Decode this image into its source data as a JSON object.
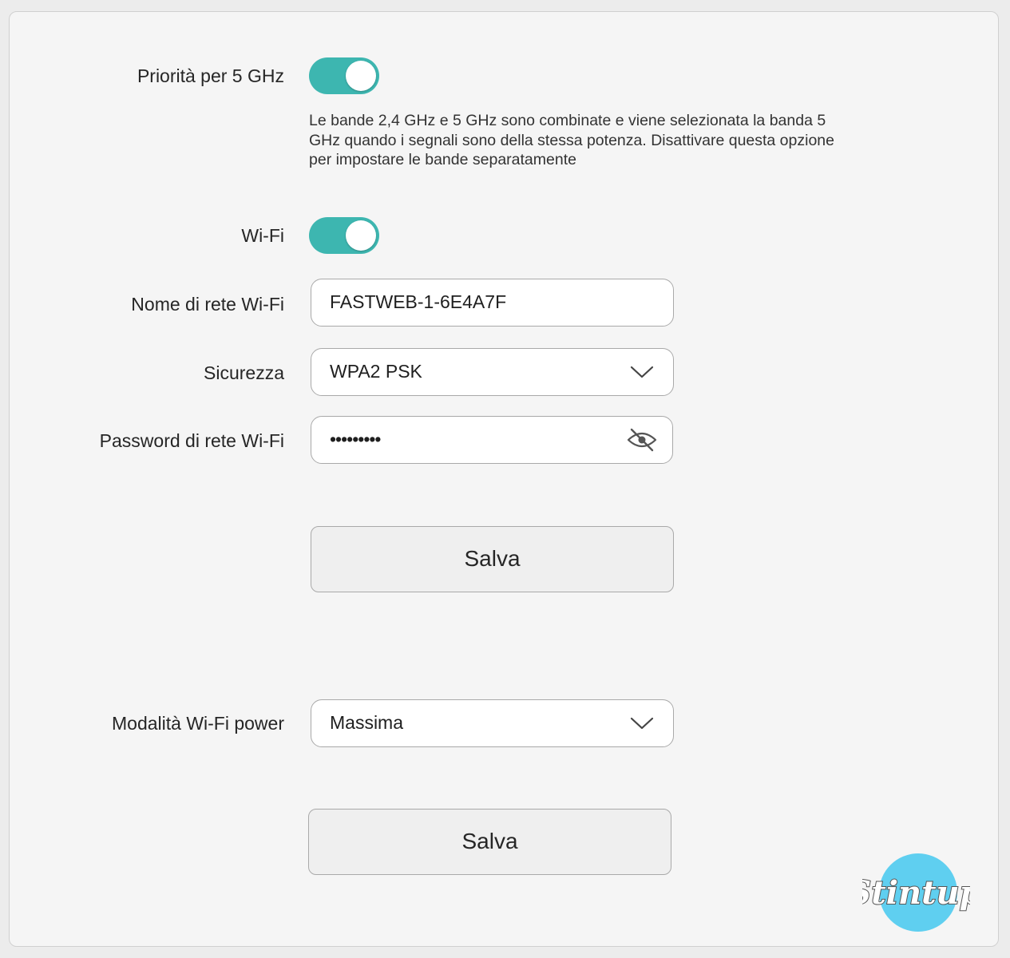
{
  "priority5ghz": {
    "label": "Priorità per 5 GHz",
    "enabled": true,
    "description": "Le bande 2,4 GHz e 5 GHz sono combinate e viene selezionata la banda 5 GHz quando i segnali sono della stessa potenza. Disattivare questa opzione per impostare le bande separatamente"
  },
  "wifi": {
    "label": "Wi-Fi",
    "enabled": true
  },
  "network_name": {
    "label": "Nome di rete Wi-Fi",
    "value": "FASTWEB-1-6E4A7F"
  },
  "security": {
    "label": "Sicurezza",
    "value": "WPA2 PSK"
  },
  "password": {
    "label": "Password di rete Wi-Fi",
    "value": "•••••••••",
    "icon": "eye-hidden-icon"
  },
  "save1": {
    "label": "Salva"
  },
  "power_mode": {
    "label": "Modalità Wi-Fi power",
    "value": "Massima"
  },
  "save2": {
    "label": "Salva"
  },
  "watermark": {
    "text": "Stintup"
  },
  "colors": {
    "toggle_on": "#3db6b0",
    "logo_circle": "#5fcff0"
  }
}
